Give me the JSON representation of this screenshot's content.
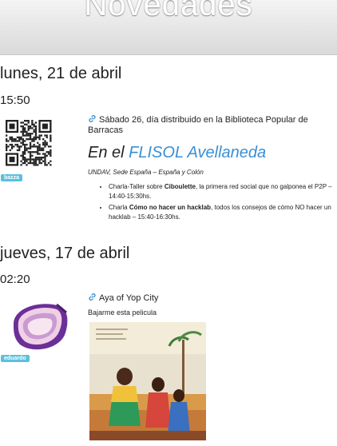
{
  "header": {
    "title": "Novedades"
  },
  "entries": [
    {
      "date": "lunes, 21 de abril",
      "time": "15:50",
      "user": "bazza",
      "link_text": "Sábado 26, día distribuido en la Biblioteca Popular de Barracas",
      "title_prefix": "En el",
      "title_highlight": "FLISOL Avellaneda",
      "meta": "UNDAV, Sede España – España y Colón",
      "talks": [
        {
          "pre": "Charla-Taller sobre",
          "bold": "Ciboulette",
          "post": ", la primera red social que no galponea el P2P – 14:40-15:30hs."
        },
        {
          "pre": "Charla",
          "bold": "Cómo no hacer un hacklab",
          "post": ", todos los consejos de cómo NO hacer un hacklab – 15:40-16:30hs."
        }
      ]
    },
    {
      "date": "jueves, 17 de abril",
      "time": "02:20",
      "user": "eduardo",
      "link_text": "Aya of Yop City",
      "subtitle": "Bajarme esta pelicula"
    }
  ],
  "colors": {
    "accent": "#3a8fd6",
    "badge": "#5bc0de",
    "onion": "#7a3fa8"
  },
  "icons": [
    "link-icon",
    "qr-code",
    "onion-avatar"
  ]
}
